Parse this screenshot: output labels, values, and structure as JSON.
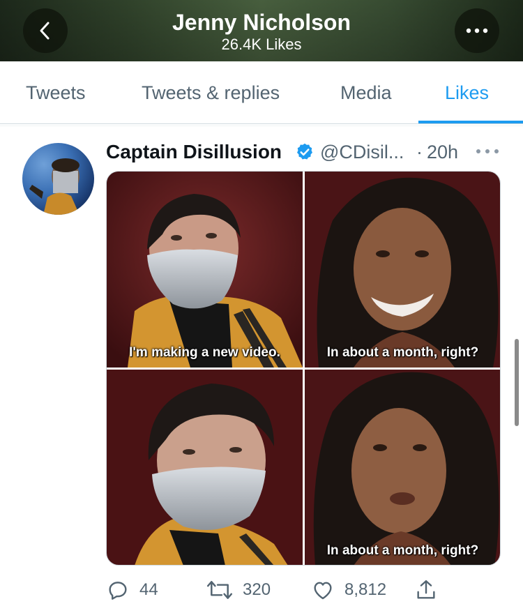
{
  "header": {
    "title": "Jenny Nicholson",
    "subtitle": "26.4K Likes"
  },
  "tabs": [
    {
      "label": "Tweets",
      "active": false
    },
    {
      "label": "Tweets & replies",
      "active": false
    },
    {
      "label": "Media",
      "active": false
    },
    {
      "label": "Likes",
      "active": true
    }
  ],
  "tweet": {
    "author_name": "Captain Disillusion",
    "verified": true,
    "handle": "@CDisil...",
    "separator": "·",
    "time": "20h",
    "media": {
      "captions": [
        "I'm making a new video.",
        "In about a month, right?",
        "",
        "In about a month, right?"
      ]
    },
    "actions": {
      "replies": "44",
      "retweets": "320",
      "likes": "8,812"
    }
  },
  "colors": {
    "accent": "#1d9bf0",
    "secondary_text": "#536471",
    "primary_text": "#0f1419"
  },
  "icons": [
    "back-icon",
    "more-icon",
    "verified-badge-icon",
    "tweet-more-icon",
    "reply-icon",
    "retweet-icon",
    "like-icon",
    "share-icon"
  ]
}
